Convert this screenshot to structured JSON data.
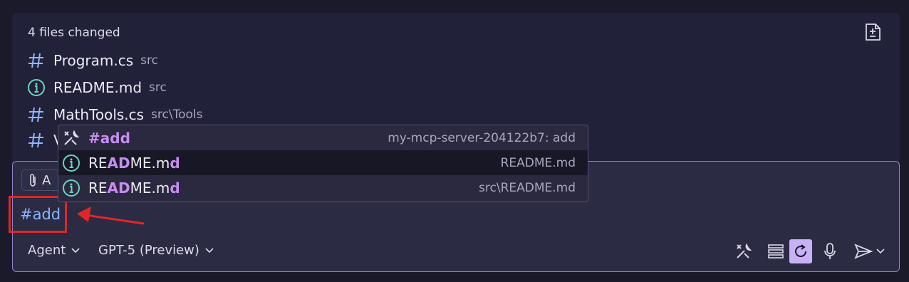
{
  "files": {
    "header": "4 files changed",
    "items": [
      {
        "name": "Program.cs",
        "path": "src",
        "icon": "hash-icon"
      },
      {
        "name": "README.md",
        "path": "src",
        "icon": "info-icon"
      },
      {
        "name": "MathTools.cs",
        "path": "src\\Tools",
        "icon": "hash-icon"
      },
      {
        "name": "V",
        "path": "",
        "icon": "hash-icon"
      }
    ]
  },
  "popup": {
    "items": [
      {
        "label_pre": "",
        "label_match": "#add",
        "label_post": "",
        "detail": "my-mcp-server-204122b7: add",
        "icon": "tools-icon"
      },
      {
        "label_pre": "RE",
        "label_match": "AD",
        "label_mid": "ME.m",
        "label_match2": "d",
        "detail": "README.md",
        "icon": "info-icon"
      },
      {
        "label_pre": "RE",
        "label_match": "AD",
        "label_mid": "ME.m",
        "label_match2": "d",
        "detail": "src\\README.md",
        "icon": "info-icon"
      }
    ]
  },
  "input": {
    "attach_label": "A",
    "text": "#add"
  },
  "toolbar": {
    "mode": "Agent",
    "model": "GPT-5 (Preview)"
  },
  "colors": {
    "accent": "#c7b2f5",
    "highlight": "#e02626",
    "match": "#c78cf2",
    "input_text": "#8ab4ff"
  }
}
